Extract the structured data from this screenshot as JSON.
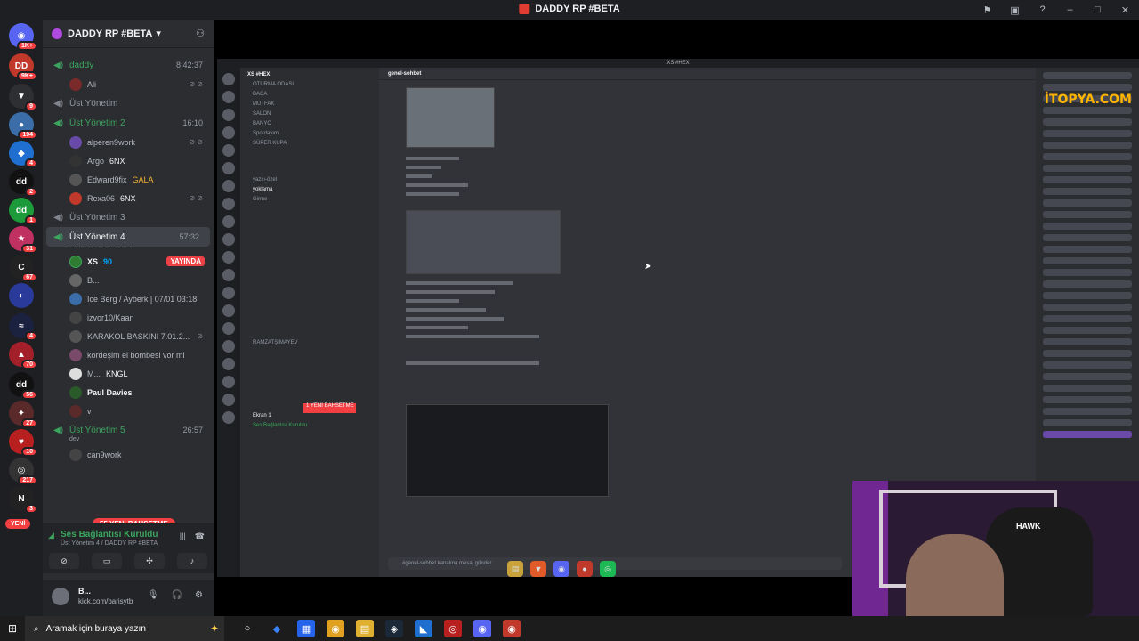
{
  "window": {
    "title": "DADDY RP #BETA"
  },
  "server": {
    "name": "DADDY RP #BETA"
  },
  "guild_badges": [
    "1K+",
    "9K+",
    "9",
    "194",
    "4",
    "2",
    "1",
    "31",
    "67",
    "4",
    "70",
    "56",
    "27",
    "10",
    "217",
    "3"
  ],
  "channels": [
    {
      "name": "daddy",
      "time": "8:42:37",
      "members": [
        {
          "name": "Ali"
        }
      ]
    },
    {
      "name": "Üst Yönetim",
      "members": []
    },
    {
      "name": "Üst Yönetim 2",
      "time": "16:10",
      "members": [
        {
          "name": "alperen9work"
        },
        {
          "name": "Argo",
          "tag": "6NX"
        },
        {
          "name": "Edward9fix",
          "tag": "GALA"
        },
        {
          "name": "Rexa06",
          "tag": "6NX"
        }
      ]
    },
    {
      "name": "Üst Yönetim 3",
      "members": []
    },
    {
      "name": "Üst Yönetim 4",
      "time": "57:32",
      "subtitle": "Bir kanal durumu belirle",
      "members": [
        {
          "name": "XS",
          "tag": "90",
          "live": "YAYINDA"
        },
        {
          "name": "B..."
        },
        {
          "name": "Ice Berg / Ayberk | 07/01 03:18"
        },
        {
          "name": "izvor10/Kaan"
        },
        {
          "name": "KARAKOL BASKINI 7.01.2..."
        },
        {
          "name": "kordeşim el bombesi vor mi"
        },
        {
          "name": "M...",
          "tag": "KNGL"
        },
        {
          "name": "Paul Davies"
        },
        {
          "name": "v"
        }
      ]
    },
    {
      "name": "Üst Yönetim 5",
      "time": "26:57",
      "subtitle": "dev",
      "members": [
        {
          "name": "can9work"
        }
      ]
    }
  ],
  "new_messages_pill": "55 YENİ BAHSETME",
  "new_left_badge": "YENİ",
  "voice": {
    "status": "Ses Bağlantısı Kuruldu",
    "location": "Üst Yönetim 4 / DADDY RP #BETA"
  },
  "user": {
    "name": "B...",
    "status": "kick.com/barisytb"
  },
  "stream": {
    "watermark": "İTOPYA.COM",
    "inner_title": "XS #HEX",
    "inner_server": "XS #HEX",
    "inner_channel": "genel-sohbet",
    "inner_composer": "#genel-sohbet kanalına mesaj gönder",
    "inner_channels": [
      "OTURMA ODASI",
      "BACA",
      "MUTFAK",
      "SALON",
      "BANYO",
      "Spordayım",
      "SÜPER KUPA",
      "yazılı-özel",
      "yoklama",
      "Girme",
      "RAMZATŞIMAYEV",
      "Ekran 1"
    ],
    "inner_voice_status": "Ses Bağlantısı Kuruldu",
    "inner_new_pill": "1 YENİ BAHSETME",
    "webcam_brand": "HAWK"
  },
  "taskbar": {
    "search_placeholder": "Aramak için buraya yazın"
  }
}
